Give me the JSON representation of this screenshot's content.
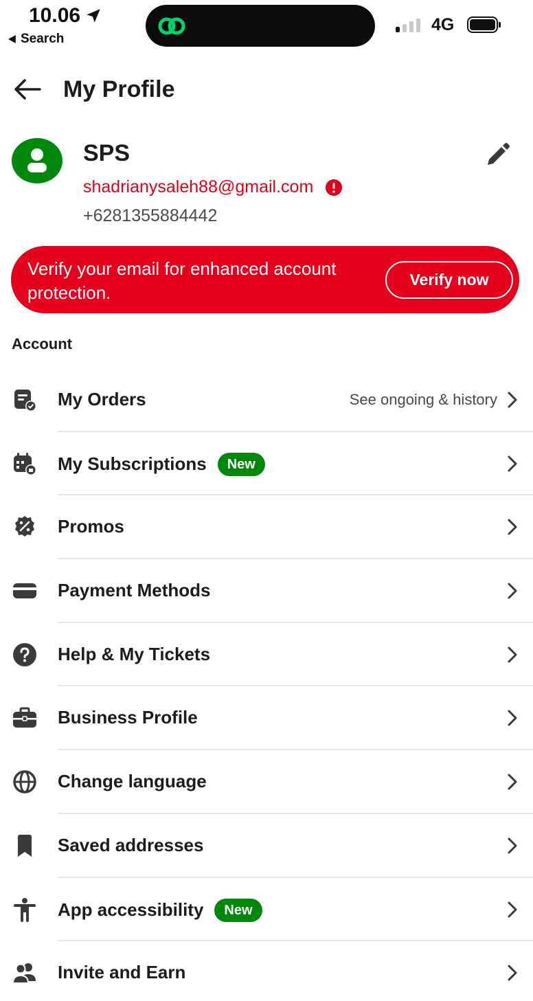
{
  "status_bar": {
    "time": "10.06",
    "back_label": "Search",
    "network": "4G"
  },
  "header": {
    "title": "My Profile"
  },
  "profile": {
    "name": "SPS",
    "email": "shadrianysaleh88@gmail.com",
    "phone": "+6281355884442"
  },
  "verify_banner": {
    "message": "Verify your email for enhanced account protection.",
    "button_label": "Verify now"
  },
  "section": {
    "title": "Account"
  },
  "menu": {
    "items": [
      {
        "label": "My Orders",
        "icon": "orders-icon",
        "sub": "See ongoing & history"
      },
      {
        "label": "My Subscriptions",
        "icon": "subscriptions-icon",
        "badge": "New"
      },
      {
        "label": "Promos",
        "icon": "promo-icon"
      },
      {
        "label": "Payment Methods",
        "icon": "card-icon"
      },
      {
        "label": "Help & My Tickets",
        "icon": "help-icon"
      },
      {
        "label": "Business Profile",
        "icon": "briefcase-icon"
      },
      {
        "label": "Change language",
        "icon": "globe-icon"
      },
      {
        "label": "Saved addresses",
        "icon": "bookmark-icon"
      },
      {
        "label": "App accessibility",
        "icon": "accessibility-icon",
        "badge": "New"
      },
      {
        "label": "Invite and Earn",
        "icon": "users-icon"
      }
    ]
  },
  "colors": {
    "brand_red": "#e6001d",
    "brand_green": "#00880d",
    "text": "#1c1c1c",
    "muted": "#4a4a4a"
  }
}
